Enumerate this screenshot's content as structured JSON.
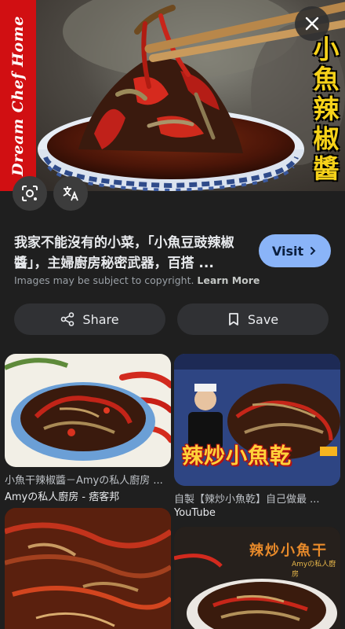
{
  "hero": {
    "banner_text": "Dream Chef Home",
    "vertical_title_chars": [
      "小",
      "魚",
      "辣",
      "椒",
      "醬"
    ]
  },
  "result": {
    "title": "我家不能沒有的小菜，「小魚豆豉辣椒醬」，主婦廚房秘密武器，百搭 ...",
    "visit_label": "Visit",
    "copyright_text": "Images may be subject to copyright.",
    "learn_more_label": "Learn More"
  },
  "actions": {
    "share_label": "Share",
    "save_label": "Save"
  },
  "related": [
    {
      "caption": "小魚干辣椒醬－Amyの私人廚房 ...",
      "source": "Amyの私人廚房 - 痞客邦"
    },
    {
      "image_text": "辣炒小魚乾",
      "caption": "自製【辣炒小魚乾】自己做最 ...",
      "source": "YouTube"
    },
    {
      "caption": "",
      "source": ""
    },
    {
      "image_text": "辣炒小魚干",
      "image_subtext": "Amyの私人廚房",
      "caption": "",
      "source": ""
    }
  ],
  "colors": {
    "background": "#1f1f1f",
    "visit_button": "#8ab4f8",
    "action_button": "#303134",
    "banner_red": "#d10f12",
    "title_yellow": "#f6d21a"
  }
}
